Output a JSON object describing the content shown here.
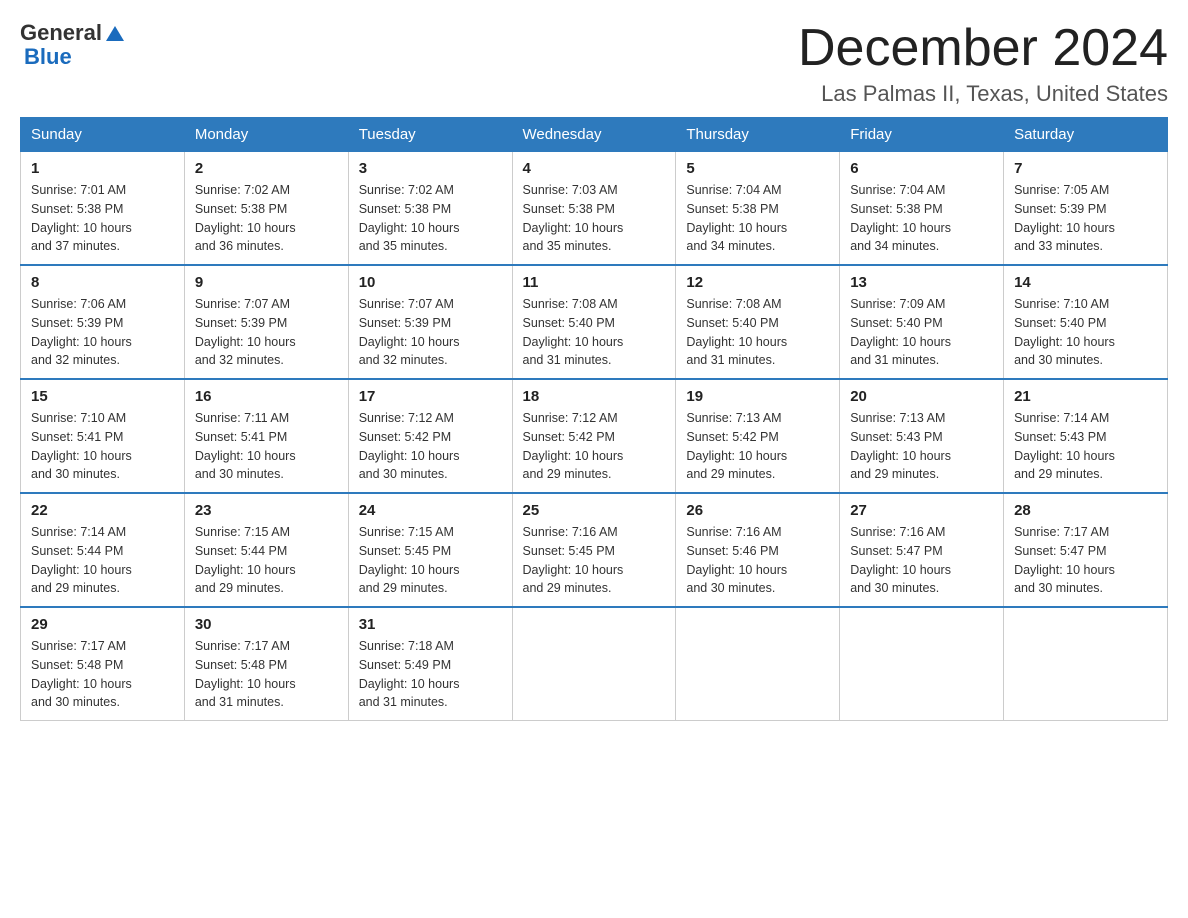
{
  "header": {
    "logo": {
      "general": "General",
      "blue": "Blue"
    },
    "title": "December 2024",
    "subtitle": "Las Palmas II, Texas, United States"
  },
  "weekdays": [
    "Sunday",
    "Monday",
    "Tuesday",
    "Wednesday",
    "Thursday",
    "Friday",
    "Saturday"
  ],
  "weeks": [
    [
      {
        "day": "1",
        "sunrise": "7:01 AM",
        "sunset": "5:38 PM",
        "daylight": "10 hours and 37 minutes."
      },
      {
        "day": "2",
        "sunrise": "7:02 AM",
        "sunset": "5:38 PM",
        "daylight": "10 hours and 36 minutes."
      },
      {
        "day": "3",
        "sunrise": "7:02 AM",
        "sunset": "5:38 PM",
        "daylight": "10 hours and 35 minutes."
      },
      {
        "day": "4",
        "sunrise": "7:03 AM",
        "sunset": "5:38 PM",
        "daylight": "10 hours and 35 minutes."
      },
      {
        "day": "5",
        "sunrise": "7:04 AM",
        "sunset": "5:38 PM",
        "daylight": "10 hours and 34 minutes."
      },
      {
        "day": "6",
        "sunrise": "7:04 AM",
        "sunset": "5:38 PM",
        "daylight": "10 hours and 34 minutes."
      },
      {
        "day": "7",
        "sunrise": "7:05 AM",
        "sunset": "5:39 PM",
        "daylight": "10 hours and 33 minutes."
      }
    ],
    [
      {
        "day": "8",
        "sunrise": "7:06 AM",
        "sunset": "5:39 PM",
        "daylight": "10 hours and 32 minutes."
      },
      {
        "day": "9",
        "sunrise": "7:07 AM",
        "sunset": "5:39 PM",
        "daylight": "10 hours and 32 minutes."
      },
      {
        "day": "10",
        "sunrise": "7:07 AM",
        "sunset": "5:39 PM",
        "daylight": "10 hours and 32 minutes."
      },
      {
        "day": "11",
        "sunrise": "7:08 AM",
        "sunset": "5:40 PM",
        "daylight": "10 hours and 31 minutes."
      },
      {
        "day": "12",
        "sunrise": "7:08 AM",
        "sunset": "5:40 PM",
        "daylight": "10 hours and 31 minutes."
      },
      {
        "day": "13",
        "sunrise": "7:09 AM",
        "sunset": "5:40 PM",
        "daylight": "10 hours and 31 minutes."
      },
      {
        "day": "14",
        "sunrise": "7:10 AM",
        "sunset": "5:40 PM",
        "daylight": "10 hours and 30 minutes."
      }
    ],
    [
      {
        "day": "15",
        "sunrise": "7:10 AM",
        "sunset": "5:41 PM",
        "daylight": "10 hours and 30 minutes."
      },
      {
        "day": "16",
        "sunrise": "7:11 AM",
        "sunset": "5:41 PM",
        "daylight": "10 hours and 30 minutes."
      },
      {
        "day": "17",
        "sunrise": "7:12 AM",
        "sunset": "5:42 PM",
        "daylight": "10 hours and 30 minutes."
      },
      {
        "day": "18",
        "sunrise": "7:12 AM",
        "sunset": "5:42 PM",
        "daylight": "10 hours and 29 minutes."
      },
      {
        "day": "19",
        "sunrise": "7:13 AM",
        "sunset": "5:42 PM",
        "daylight": "10 hours and 29 minutes."
      },
      {
        "day": "20",
        "sunrise": "7:13 AM",
        "sunset": "5:43 PM",
        "daylight": "10 hours and 29 minutes."
      },
      {
        "day": "21",
        "sunrise": "7:14 AM",
        "sunset": "5:43 PM",
        "daylight": "10 hours and 29 minutes."
      }
    ],
    [
      {
        "day": "22",
        "sunrise": "7:14 AM",
        "sunset": "5:44 PM",
        "daylight": "10 hours and 29 minutes."
      },
      {
        "day": "23",
        "sunrise": "7:15 AM",
        "sunset": "5:44 PM",
        "daylight": "10 hours and 29 minutes."
      },
      {
        "day": "24",
        "sunrise": "7:15 AM",
        "sunset": "5:45 PM",
        "daylight": "10 hours and 29 minutes."
      },
      {
        "day": "25",
        "sunrise": "7:16 AM",
        "sunset": "5:45 PM",
        "daylight": "10 hours and 29 minutes."
      },
      {
        "day": "26",
        "sunrise": "7:16 AM",
        "sunset": "5:46 PM",
        "daylight": "10 hours and 30 minutes."
      },
      {
        "day": "27",
        "sunrise": "7:16 AM",
        "sunset": "5:47 PM",
        "daylight": "10 hours and 30 minutes."
      },
      {
        "day": "28",
        "sunrise": "7:17 AM",
        "sunset": "5:47 PM",
        "daylight": "10 hours and 30 minutes."
      }
    ],
    [
      {
        "day": "29",
        "sunrise": "7:17 AM",
        "sunset": "5:48 PM",
        "daylight": "10 hours and 30 minutes."
      },
      {
        "day": "30",
        "sunrise": "7:17 AM",
        "sunset": "5:48 PM",
        "daylight": "10 hours and 31 minutes."
      },
      {
        "day": "31",
        "sunrise": "7:18 AM",
        "sunset": "5:49 PM",
        "daylight": "10 hours and 31 minutes."
      },
      null,
      null,
      null,
      null
    ]
  ],
  "labels": {
    "sunrise": "Sunrise:",
    "sunset": "Sunset:",
    "daylight": "Daylight:"
  }
}
